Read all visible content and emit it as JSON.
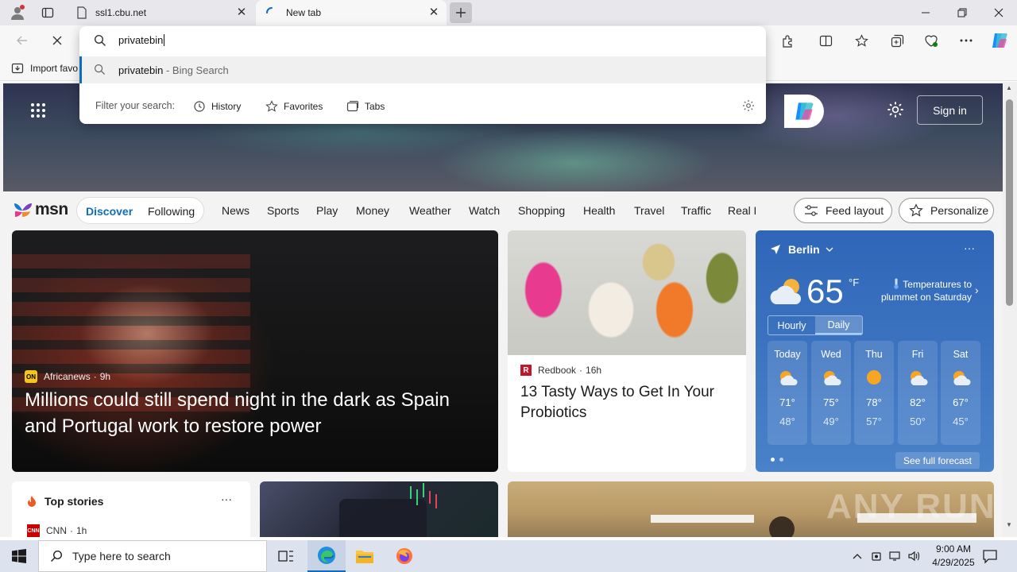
{
  "browser": {
    "tabs": [
      {
        "title": "ssl1.cbu.net",
        "active": false
      },
      {
        "title": "New tab",
        "active": true
      }
    ],
    "address_value": "privatebin",
    "favorites_bar": {
      "import_label": "Import favo"
    }
  },
  "omnibox": {
    "query": "privatebin",
    "suggestion": {
      "term": "privatebin",
      "suffix": " - Bing Search"
    },
    "filter_label": "Filter your search:",
    "filters": [
      "History",
      "Favorites",
      "Tabs"
    ]
  },
  "msn": {
    "logo": "msn",
    "signin_label": "Sign in",
    "pill_tabs": [
      {
        "label": "Discover",
        "active": true
      },
      {
        "label": "Following",
        "active": false
      }
    ],
    "nav_links": [
      "News",
      "Sports",
      "Play",
      "Money",
      "Weather",
      "Watch",
      "Shopping",
      "Health",
      "Travel",
      "Traffic",
      "Real E"
    ],
    "feed_layout_label": "Feed layout",
    "personalize_label": "Personalize"
  },
  "cards": {
    "main": {
      "source": "Africanews",
      "badge": "ON",
      "age": "9h",
      "headline": "Millions could still spend night in the dark as Spain and Portugal work to restore power"
    },
    "second": {
      "source": "Redbook",
      "badge": "R",
      "age": "16h",
      "headline": "13 Tasty Ways to Get In Your Probiotics"
    },
    "top_stories": {
      "title": "Top stories",
      "more": "···",
      "first_source": "CNN",
      "first_badge": "CNN",
      "first_age": "1h"
    }
  },
  "weather": {
    "city": "Berlin",
    "more": "···",
    "temp": "65",
    "unit": "°F",
    "alert": "Temperatures to plummet on Saturday",
    "toggle": [
      "Hourly",
      "Daily"
    ],
    "active_toggle": "Daily",
    "days": [
      {
        "name": "Today",
        "hi": "71°",
        "lo": "48°",
        "icon": "partly-cloudy-icon"
      },
      {
        "name": "Wed",
        "hi": "75°",
        "lo": "49°",
        "icon": "partly-cloudy-icon"
      },
      {
        "name": "Thu",
        "hi": "78°",
        "lo": "57°",
        "icon": "sunny-icon"
      },
      {
        "name": "Fri",
        "hi": "82°",
        "lo": "50°",
        "icon": "partly-cloudy-icon"
      },
      {
        "name": "Sat",
        "hi": "67°",
        "lo": "45°",
        "icon": "partly-cloudy-icon"
      }
    ],
    "see_full": "See full forecast"
  },
  "watermark": "ANY RUN",
  "taskbar": {
    "search_placeholder": "Type here to search",
    "time": "9:00 AM",
    "date": "4/29/2025"
  },
  "colors": {
    "accent": "#0f6cbd",
    "weather_bg": "#2f66b8",
    "taskbar": "#dde3ee"
  }
}
